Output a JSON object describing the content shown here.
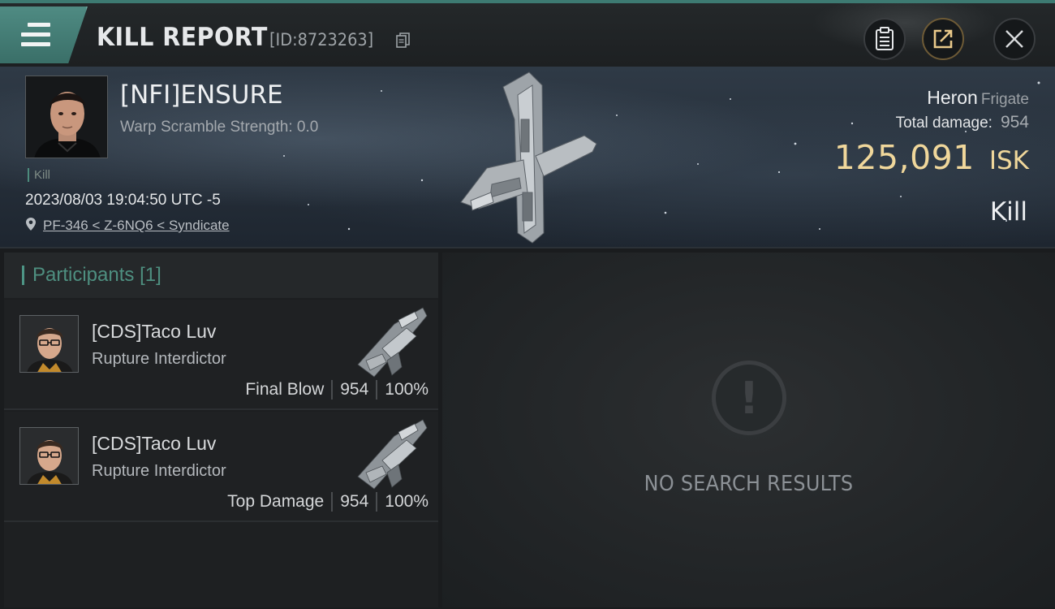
{
  "header": {
    "title": "KILL REPORT",
    "id_text": "[ID:8723263]",
    "icons": [
      "menu-icon",
      "copy-icon",
      "clipboard-icon",
      "share-icon",
      "close-icon"
    ]
  },
  "victim": {
    "name": "[NFI]ENSURE",
    "warp_scramble": "Warp Scramble Strength: 0.0",
    "kill_tag": "Kill",
    "datetime": "2023/08/03 19:04:50 UTC -5",
    "location": "PF-346 < Z-6NQ6 < Syndicate",
    "ship_name": "Heron",
    "ship_class": "Frigate",
    "total_damage_label": "Total damage:",
    "total_damage_value": "954",
    "isk_value": "125,091",
    "isk_unit": "ISK",
    "result": "Kill"
  },
  "participants": {
    "header_label": "Participants",
    "count": "[1]",
    "items": [
      {
        "name": "[CDS]Taco Luv",
        "ship": "Rupture Interdictor",
        "role": "Final Blow",
        "damage": "954",
        "percent": "100%"
      },
      {
        "name": "[CDS]Taco Luv",
        "ship": "Rupture Interdictor",
        "role": "Top Damage",
        "damage": "954",
        "percent": "100%"
      }
    ]
  },
  "results_panel": {
    "empty_text": "NO SEARCH RESULTS",
    "icon": "exclamation-icon"
  },
  "colors": {
    "accent": "#4e8f80",
    "isk_gold": "#f0d79b"
  }
}
